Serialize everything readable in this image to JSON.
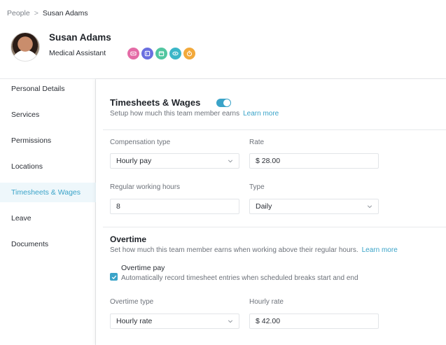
{
  "breadcrumb": {
    "parent": "People",
    "separator": ">",
    "current": "Susan Adams"
  },
  "profile": {
    "name": "Susan Adams",
    "role": "Medical Assistant",
    "role_icons": [
      {
        "icon": "ticket-icon",
        "color": "#e46ba6"
      },
      {
        "icon": "tag-icon",
        "color": "#6a6fe0"
      },
      {
        "icon": "calendar-icon",
        "color": "#52c6a0"
      },
      {
        "icon": "eye-icon",
        "color": "#3bb6c8"
      },
      {
        "icon": "clock-icon",
        "color": "#f2a93b"
      }
    ]
  },
  "sidebar": {
    "items": [
      {
        "label": "Personal Details",
        "active": false
      },
      {
        "label": "Services",
        "active": false
      },
      {
        "label": "Permissions",
        "active": false
      },
      {
        "label": "Locations",
        "active": false
      },
      {
        "label": "Timesheets & Wages",
        "active": true
      },
      {
        "label": "Leave",
        "active": false
      },
      {
        "label": "Documents",
        "active": false
      }
    ]
  },
  "timesheets": {
    "title": "Timesheets & Wages",
    "enabled": true,
    "subtitle": "Setup how much this team member earns",
    "learn_more": "Learn more",
    "compensation_type_label": "Compensation type",
    "compensation_type_value": "Hourly pay",
    "rate_label": "Rate",
    "rate_value": "$ 28.00",
    "regular_hours_label": "Regular working hours",
    "regular_hours_value": "8",
    "type_label": "Type",
    "type_value": "Daily"
  },
  "overtime": {
    "title": "Overtime",
    "subtitle": "Set how much this team member earns when working above their regular hours.",
    "learn_more": "Learn more",
    "checkbox_title": "Overtime pay",
    "checkbox_desc": "Automatically record timesheet entries when scheduled breaks start and end",
    "checkbox_checked": true,
    "overtime_type_label": "Overtime type",
    "overtime_type_value": "Hourly rate",
    "hourly_rate_label": "Hourly rate",
    "hourly_rate_value": "$ 42.00"
  },
  "colors": {
    "accent": "#3aa3c8",
    "active_bg": "#eef7fb"
  }
}
